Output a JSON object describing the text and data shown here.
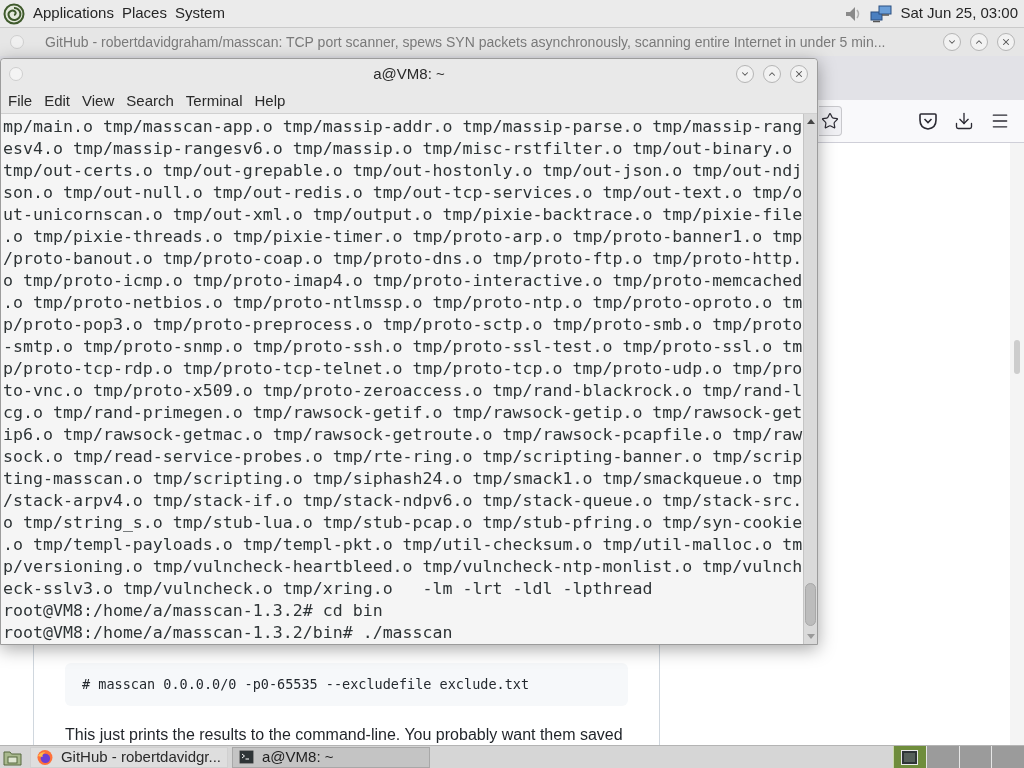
{
  "top_panel": {
    "menus": [
      "Applications",
      "Places",
      "System"
    ],
    "clock": "Sat Jun 25, 03:00"
  },
  "browser": {
    "title": "GitHub - robertdavidgraham/masscan: TCP port scanner, spews SYN packets asynchronously, scanning entire Internet in under 5 min...",
    "code_block": "# masscan 0.0.0.0/0 -p0-65535 --excludefile exclude.txt",
    "paragraph": "This just prints the results to the command-line. You probably want them saved"
  },
  "terminal": {
    "title": "a@VM8: ~",
    "menus": [
      "File",
      "Edit",
      "View",
      "Search",
      "Terminal",
      "Help"
    ],
    "lines": [
      "mp/main.o tmp/masscan-app.o tmp/massip-addr.o tmp/massip-parse.o tmp/massip-rang",
      "esv4.o tmp/massip-rangesv6.o tmp/massip.o tmp/misc-rstfilter.o tmp/out-binary.o",
      "tmp/out-certs.o tmp/out-grepable.o tmp/out-hostonly.o tmp/out-json.o tmp/out-ndj",
      "son.o tmp/out-null.o tmp/out-redis.o tmp/out-tcp-services.o tmp/out-text.o tmp/o",
      "ut-unicornscan.o tmp/out-xml.o tmp/output.o tmp/pixie-backtrace.o tmp/pixie-file",
      ".o tmp/pixie-threads.o tmp/pixie-timer.o tmp/proto-arp.o tmp/proto-banner1.o tmp",
      "/proto-banout.o tmp/proto-coap.o tmp/proto-dns.o tmp/proto-ftp.o tmp/proto-http.",
      "o tmp/proto-icmp.o tmp/proto-imap4.o tmp/proto-interactive.o tmp/proto-memcached",
      ".o tmp/proto-netbios.o tmp/proto-ntlmssp.o tmp/proto-ntp.o tmp/proto-oproto.o tm",
      "p/proto-pop3.o tmp/proto-preprocess.o tmp/proto-sctp.o tmp/proto-smb.o tmp/proto",
      "-smtp.o tmp/proto-snmp.o tmp/proto-ssh.o tmp/proto-ssl-test.o tmp/proto-ssl.o tm",
      "p/proto-tcp-rdp.o tmp/proto-tcp-telnet.o tmp/proto-tcp.o tmp/proto-udp.o tmp/pro",
      "to-vnc.o tmp/proto-x509.o tmp/proto-zeroaccess.o tmp/rand-blackrock.o tmp/rand-l",
      "cg.o tmp/rand-primegen.o tmp/rawsock-getif.o tmp/rawsock-getip.o tmp/rawsock-get",
      "ip6.o tmp/rawsock-getmac.o tmp/rawsock-getroute.o tmp/rawsock-pcapfile.o tmp/raw",
      "sock.o tmp/read-service-probes.o tmp/rte-ring.o tmp/scripting-banner.o tmp/scrip",
      "ting-masscan.o tmp/scripting.o tmp/siphash24.o tmp/smack1.o tmp/smackqueue.o tmp",
      "/stack-arpv4.o tmp/stack-if.o tmp/stack-ndpv6.o tmp/stack-queue.o tmp/stack-src.",
      "o tmp/string_s.o tmp/stub-lua.o tmp/stub-pcap.o tmp/stub-pfring.o tmp/syn-cookie",
      ".o tmp/templ-payloads.o tmp/templ-pkt.o tmp/util-checksum.o tmp/util-malloc.o tm",
      "p/versioning.o tmp/vulncheck-heartbleed.o tmp/vulncheck-ntp-monlist.o tmp/vulnch",
      "eck-sslv3.o tmp/vulncheck.o tmp/xring.o   -lm -lrt -ldl -lpthread",
      "root@VM8:/home/a/masscan-1.3.2# cd bin",
      "root@VM8:/home/a/masscan-1.3.2/bin# ./masscan"
    ]
  },
  "taskbar": {
    "tasks": [
      {
        "kind": "browser",
        "label": "GitHub - robertdavidgr...",
        "selected": false
      },
      {
        "kind": "terminal",
        "label": "a@VM8: ~",
        "selected": true
      }
    ],
    "workspaces": [
      {
        "selected": true,
        "has_windows": true
      },
      {
        "selected": false,
        "has_windows": false
      },
      {
        "selected": false,
        "has_windows": false
      },
      {
        "selected": false,
        "has_windows": false
      }
    ]
  }
}
